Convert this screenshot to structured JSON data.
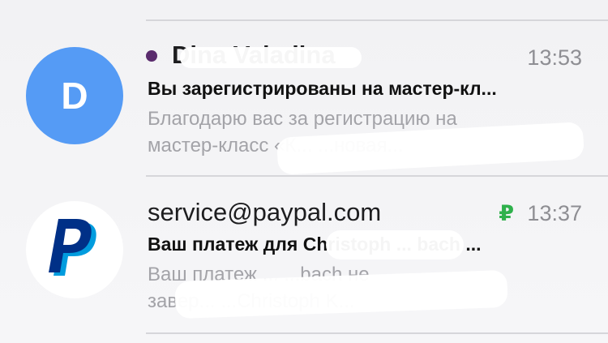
{
  "messages": [
    {
      "sender": "Dina Valadina",
      "time": "13:53",
      "subject": "Вы зарегистрированы на мастер-кл...",
      "preview_line1": "Благодарю вас за регистрацию на",
      "preview_line2": "мастер-класс «К... ...новая...",
      "avatar_letter": "D",
      "avatar_color": "#559bf5",
      "unread": true
    },
    {
      "sender": "service@paypal.com",
      "time": "13:37",
      "currency_symbol": "₽",
      "subject": "Ваш платеж для Christoph ... bach ...",
      "preview_line1": "Ваш платеж ... ...bach не",
      "preview_line2": "завер... ...Christoph K...",
      "avatar_icon": "paypal-logo",
      "unread": false
    }
  ]
}
